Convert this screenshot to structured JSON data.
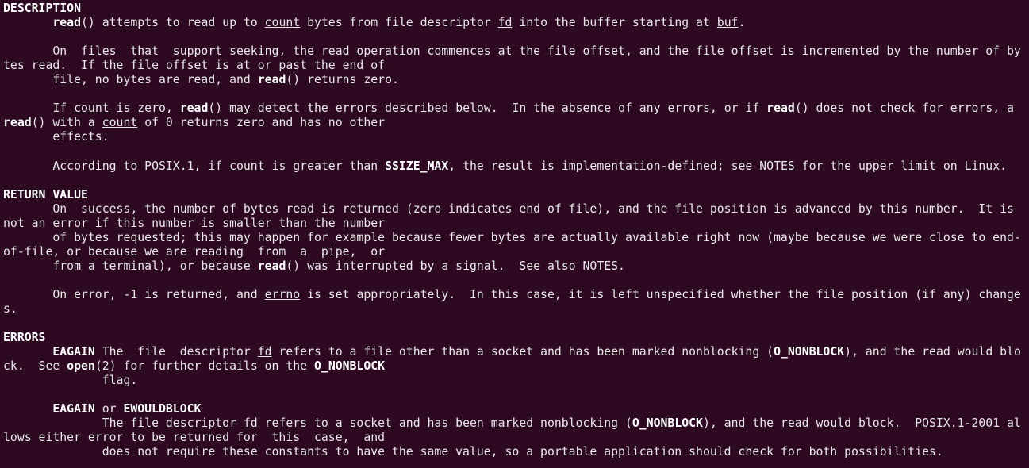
{
  "h": {
    "description": "DESCRIPTION",
    "return_value": "RETURN VALUE",
    "errors": "ERRORS"
  },
  "w": {
    "read": "read",
    "count": "count",
    "fd": "fd",
    "buf": "buf",
    "may": "may",
    "errno": "errno",
    "ssize_max": "SSIZE_MAX",
    "o_nonblock": "O_NONBLOCK",
    "open": "open",
    "eagain": "EAGAIN",
    "ewouldblock": "EWOULDBLOCK"
  },
  "t": {
    "desc_p1a": "() attempts to read up to ",
    "desc_p1b": " bytes from file descriptor ",
    "desc_p1c": " into the buffer starting at ",
    "desc_p2a": "       On  files  that  support seeking, the read operation commences at the file offset, and the file offset is incremented by the number of bytes read.  If the file offset is at or past the end of",
    "desc_p2b": "       file, no bytes are read, and ",
    "desc_p2c": "() returns zero.",
    "desc_p3a": "       If ",
    "desc_p3b": " is zero, ",
    "desc_p3c": "() ",
    "desc_p3d": " detect the errors described below.  In the absence of any errors, or if ",
    "desc_p3e": "() does not check for errors, a ",
    "desc_p3f": "() with a ",
    "desc_p3g": " of 0 returns zero and has no other",
    "desc_p3h": "       effects.",
    "desc_p4a": "       According to POSIX.1, if ",
    "desc_p4b": " is greater than ",
    "desc_p4c": ", the result is implementation-defined; see NOTES for the upper limit on Linux.",
    "rv_p1a": "       On  success, the number of bytes read is returned (zero indicates end of file), and the file position is advanced by this number.  It is not an error if this number is smaller than the number",
    "rv_p1b": "       of bytes requested; this may happen for example because fewer bytes are actually available right now (maybe because we were close to end-of-file, or because we are reading  from  a  pipe,  or",
    "rv_p1c": "       from a terminal), or because ",
    "rv_p1d": "() was interrupted by a signal.  See also NOTES.",
    "rv_p2a": "       On error, -1 is returned, and ",
    "rv_p2b": " is set appropriately.  In this case, it is left unspecified whether the file position (if any) changes.",
    "er_eagain_a": " The  file  descriptor ",
    "er_eagain_b": " refers to a file other than a socket and has been marked nonblocking (",
    "er_eagain_c": "), and the read would block.  See ",
    "er_eagain_d": "(2) for further details on the ",
    "er_eagain_e": "              flag.",
    "er_or": " or ",
    "er_wb_a": "              The file descriptor ",
    "er_wb_b": " refers to a socket and has been marked nonblocking (",
    "er_wb_c": "), and the read would block.  POSIX.1-2001 allows either error to be returned for  this  case,  and",
    "er_wb_d": "              does not require these constants to have the same value, so a portable application should check for both possibilities."
  }
}
